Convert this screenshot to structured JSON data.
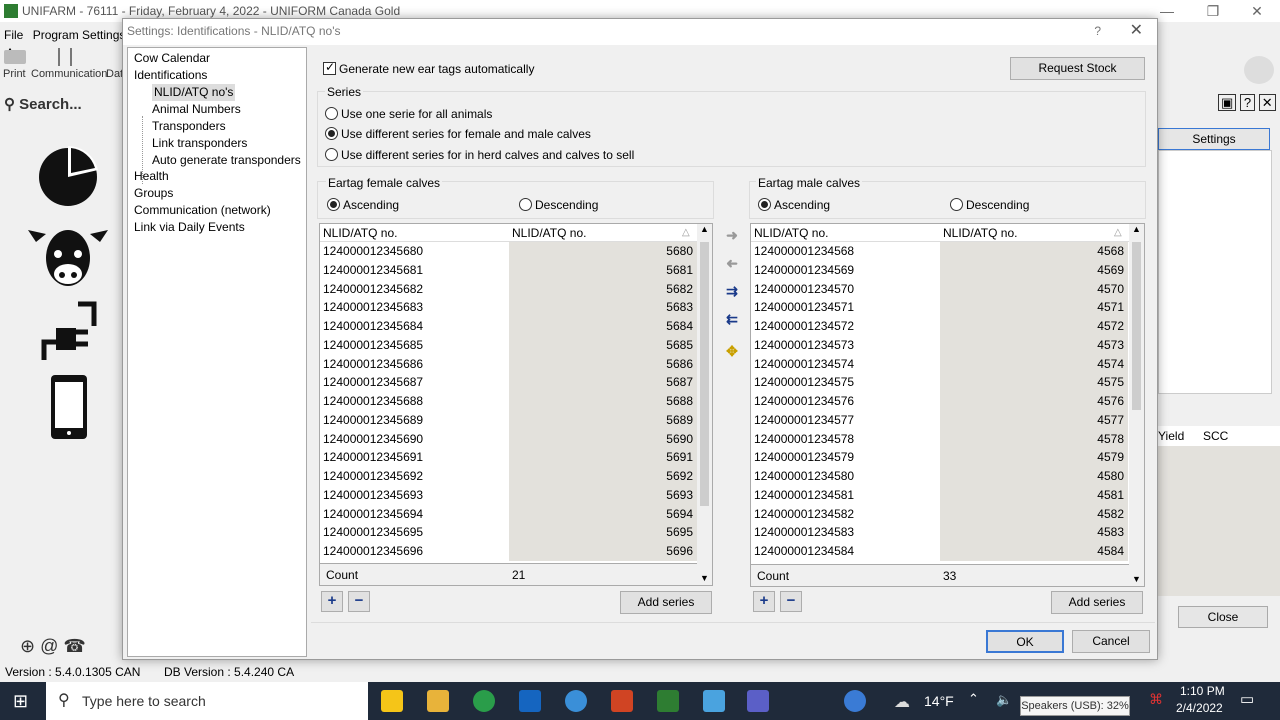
{
  "background_app": {
    "title": "UNIFARM - 76111 - Friday, February 4, 2022 - UNIFORM Canada Gold",
    "menu": [
      "File",
      "Program Settings",
      "A"
    ],
    "toolbar": [
      "Print",
      "Communication",
      "Dat"
    ],
    "search_label": "Search...",
    "right_settings_button": "Settings",
    "right_grid_headers": [
      "Yield",
      "SCC"
    ],
    "right_close_button": "Close",
    "status_version": "Version : 5.4.0.1305 CAN",
    "status_db_version": "DB Version : 5.4.240 CA"
  },
  "dialog": {
    "title": "Settings: Identifications - NLID/ATQ no's",
    "help_glyph": "?",
    "close_glyph": "✕",
    "tree": [
      {
        "label": "Cow Calendar",
        "level": 0
      },
      {
        "label": "Identifications",
        "level": 0
      },
      {
        "label": "NLID/ATQ no's",
        "level": 1,
        "selected": true
      },
      {
        "label": "Animal Numbers",
        "level": 1
      },
      {
        "label": "Transponders",
        "level": 1
      },
      {
        "label": "Link transponders",
        "level": 1
      },
      {
        "label": "Auto generate transponders",
        "level": 1
      },
      {
        "label": "Health",
        "level": 0
      },
      {
        "label": "Groups",
        "level": 0
      },
      {
        "label": "Communication (network)",
        "level": 0
      },
      {
        "label": "Link via Daily Events",
        "level": 0
      }
    ],
    "generate_checkbox": {
      "label": "Generate new ear tags automatically",
      "checked": true
    },
    "request_stock_button": "Request Stock",
    "series": {
      "label": "Series",
      "options": [
        {
          "label": "Use one serie for all animals",
          "selected": false
        },
        {
          "label": "Use different series for female and male calves",
          "selected": true
        },
        {
          "label": "Use different series for in herd calves and calves to sell",
          "selected": false
        }
      ]
    },
    "female": {
      "group_label": "Eartag female calves",
      "ascending_label": "Ascending",
      "descending_label": "Descending",
      "columns": [
        "NLID/ATQ no.",
        "NLID/ATQ no."
      ],
      "rows": [
        [
          "124000012345680",
          "5680"
        ],
        [
          "124000012345681",
          "5681"
        ],
        [
          "124000012345682",
          "5682"
        ],
        [
          "124000012345683",
          "5683"
        ],
        [
          "124000012345684",
          "5684"
        ],
        [
          "124000012345685",
          "5685"
        ],
        [
          "124000012345686",
          "5686"
        ],
        [
          "124000012345687",
          "5687"
        ],
        [
          "124000012345688",
          "5688"
        ],
        [
          "124000012345689",
          "5689"
        ],
        [
          "124000012345690",
          "5690"
        ],
        [
          "124000012345691",
          "5691"
        ],
        [
          "124000012345692",
          "5692"
        ],
        [
          "124000012345693",
          "5693"
        ],
        [
          "124000012345694",
          "5694"
        ],
        [
          "124000012345695",
          "5695"
        ],
        [
          "124000012345696",
          "5696"
        ]
      ],
      "count_label": "Count",
      "count_value": "21",
      "add_series_button": "Add series"
    },
    "male": {
      "group_label": "Eartag male calves",
      "ascending_label": "Ascending",
      "descending_label": "Descending",
      "columns": [
        "NLID/ATQ no.",
        "NLID/ATQ no."
      ],
      "rows": [
        [
          "124000001234568",
          "4568"
        ],
        [
          "124000001234569",
          "4569"
        ],
        [
          "124000001234570",
          "4570"
        ],
        [
          "124000001234571",
          "4571"
        ],
        [
          "124000001234572",
          "4572"
        ],
        [
          "124000001234573",
          "4573"
        ],
        [
          "124000001234574",
          "4574"
        ],
        [
          "124000001234575",
          "4575"
        ],
        [
          "124000001234576",
          "4576"
        ],
        [
          "124000001234577",
          "4577"
        ],
        [
          "124000001234578",
          "4578"
        ],
        [
          "124000001234579",
          "4579"
        ],
        [
          "124000001234580",
          "4580"
        ],
        [
          "124000001234581",
          "4581"
        ],
        [
          "124000001234582",
          "4582"
        ],
        [
          "124000001234583",
          "4583"
        ],
        [
          "124000001234584",
          "4584"
        ]
      ],
      "count_label": "Count",
      "count_value": "33",
      "add_series_button": "Add series"
    },
    "ok_button": "OK",
    "cancel_button": "Cancel"
  },
  "taskbar": {
    "search_placeholder": "Type here to search",
    "weather": "14°F",
    "time": "1:10 PM",
    "date": "2/4/2022",
    "volume_tooltip": "Speakers (USB): 32%"
  }
}
